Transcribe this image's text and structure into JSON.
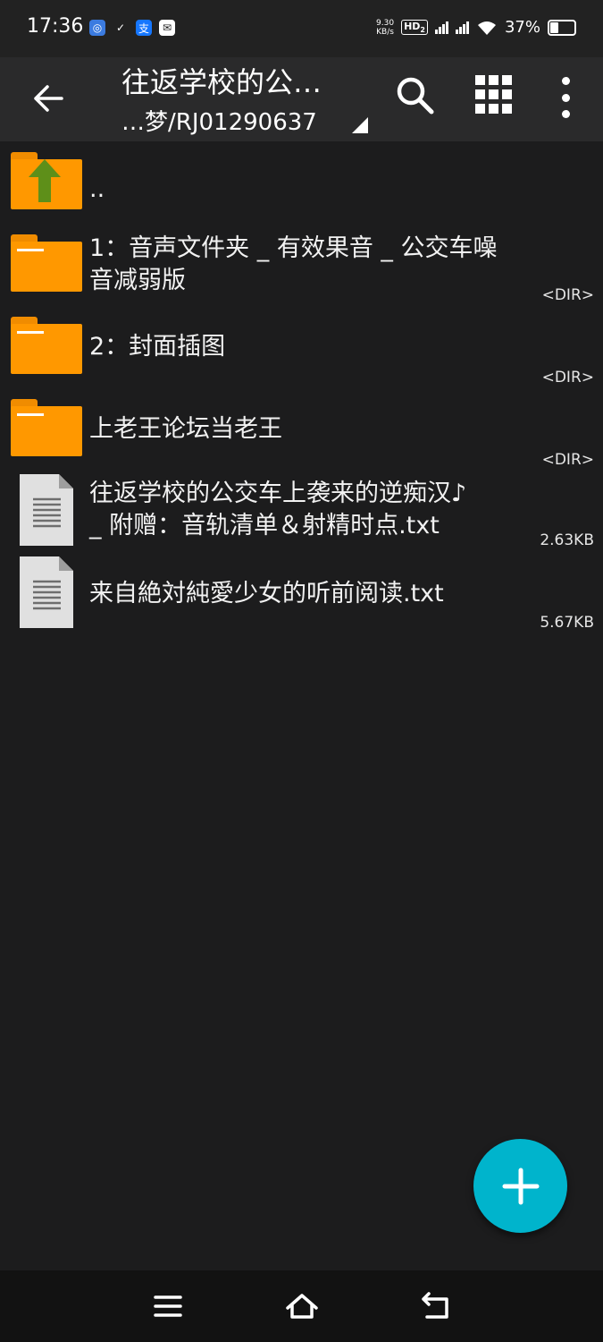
{
  "status_bar": {
    "time": "17:36",
    "speed_top": "9.30",
    "speed_unit": "KB/s",
    "hd_badge": "HD",
    "hd_sub": "2",
    "net1": "5G",
    "net2": "5G",
    "battery_percent": "37%"
  },
  "toolbar": {
    "title": "往返学校的公…",
    "path": "…梦/RJ01290637"
  },
  "files": [
    {
      "name": "..",
      "meta": "",
      "type": "parent"
    },
    {
      "name": "1：音声文件夹 _ 有效果音 _ 公交车噪",
      "name2": "音减弱版",
      "meta": "<DIR>",
      "type": "folder"
    },
    {
      "name": "2：封面插图",
      "meta": "<DIR>",
      "type": "folder"
    },
    {
      "name": "上老王论坛当老王",
      "meta": "<DIR>",
      "type": "folder"
    },
    {
      "name": "往返学校的公交车上袭来的逆痴汉♪",
      "name2": "_ 附赠：音轨清单＆射精时点.txt",
      "meta": "2.63KB",
      "type": "file"
    },
    {
      "name": "来自絶対純愛少女的听前阅读.txt",
      "meta": "5.67KB",
      "type": "file"
    }
  ],
  "colors": {
    "folder": "#ff9800",
    "fab": "#00b4cc",
    "up_arrow": "#6b9a1f"
  }
}
